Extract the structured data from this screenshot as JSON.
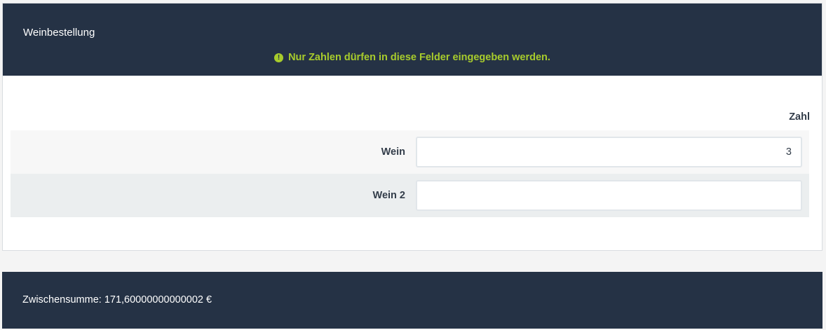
{
  "panel": {
    "title": "Weinbestellung",
    "warning_icon": "exclamation-circle-icon",
    "warning_icon_glyph": "!",
    "warning_text": "Nur Zahlen dürfen in diese Felder eingegeben werden.",
    "warning_color": "#a8cc2c",
    "header_color": "#253245"
  },
  "table": {
    "column_header": "Zahl",
    "rows": [
      {
        "label": "Wein",
        "value": "3"
      },
      {
        "label": "Wein 2",
        "value": ""
      }
    ]
  },
  "footer": {
    "subtotal_text": "Zwischensumme: 171,60000000000002 €"
  }
}
